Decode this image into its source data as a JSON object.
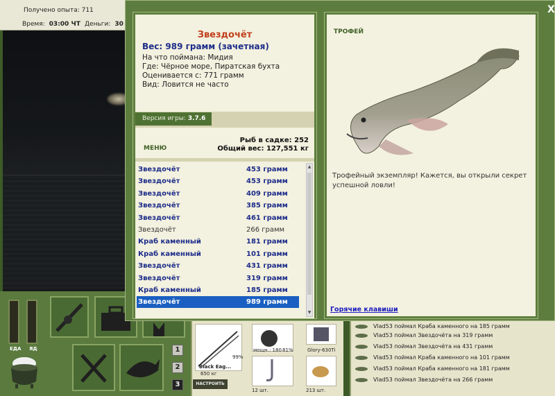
{
  "hud": {
    "xp_label": "Получено опыта: 711",
    "time_label": "Время:",
    "time_value": "03:00 ЧТ",
    "money_label": "Деньги:",
    "money_value": "30"
  },
  "meters": {
    "food_label": "ЕДА",
    "second_label": "ЯД"
  },
  "slots": [
    "1",
    "2",
    "3"
  ],
  "inventory": {
    "rod_name": "Black Eag...",
    "rod_weight": "650 кг",
    "rod_pct": "99%",
    "build_button": "НАСТРОИТЬ",
    "reel_power": "мощн.: 180",
    "reel_pct": "81%",
    "line_name": "Glory-630Ti",
    "hook_count": "12 шт.",
    "bait_count": "213 шт."
  },
  "log": [
    "Vlad53 поймал Краба каменного на 185 грамм",
    "Vlad53 поймал Звездочёта на 319 грамм",
    "Vlad53 поймал Звездочёта на 431 грамм",
    "Vlad53 поймал Краба каменного на 101 грамм",
    "Vlad53 поймал Краба каменного на 181 грамм",
    "Vlad53 поймал Звездочёта на 266 грамм"
  ],
  "modal": {
    "close": "X",
    "fish_name": "Звездочёт",
    "weight": "Вес: 989 грамм (зачетная)",
    "caught_on": "На что поймана: Мидия",
    "where": "Где: Чёрное море, Пиратская бухта",
    "rated_from": "Оценивается с: 771 грамм",
    "kind": "Вид: Ловится не часто",
    "version_label": "Версия игры:",
    "version_value": "3.7.6",
    "menu": "МЕНЮ",
    "fish_in_cage": "Рыб в садке: 252",
    "total_weight": "Общий вес: 127,551 кг",
    "catches": [
      {
        "name": "Звездочёт",
        "weight": "453 грамм",
        "style": "bold"
      },
      {
        "name": "Звездочёт",
        "weight": "453 грамм",
        "style": "bold"
      },
      {
        "name": "Звездочёт",
        "weight": "409 грамм",
        "style": "bold"
      },
      {
        "name": "Звездочёт",
        "weight": "385 грамм",
        "style": "bold"
      },
      {
        "name": "Звездочёт",
        "weight": "461 грамм",
        "style": "bold"
      },
      {
        "name": "Звездочёт",
        "weight": "266 грамм",
        "style": "plain"
      },
      {
        "name": "Краб каменный",
        "weight": "181 грамм",
        "style": "bold"
      },
      {
        "name": "Краб каменный",
        "weight": "101 грамм",
        "style": "bold"
      },
      {
        "name": "Звездочёт",
        "weight": "431 грамм",
        "style": "bold"
      },
      {
        "name": "Звездочёт",
        "weight": "319 грамм",
        "style": "bold"
      },
      {
        "name": "Краб каменный",
        "weight": "185 грамм",
        "style": "bold"
      },
      {
        "name": "Звездочёт",
        "weight": "989 грамм",
        "style": "selected"
      }
    ],
    "trophy_label": "ТРОФЕЙ",
    "trophy_text": "Трофейный экземпляр! Кажется, вы открыли секрет успешной ловли!",
    "hotkeys": "Горячие клавиши"
  }
}
